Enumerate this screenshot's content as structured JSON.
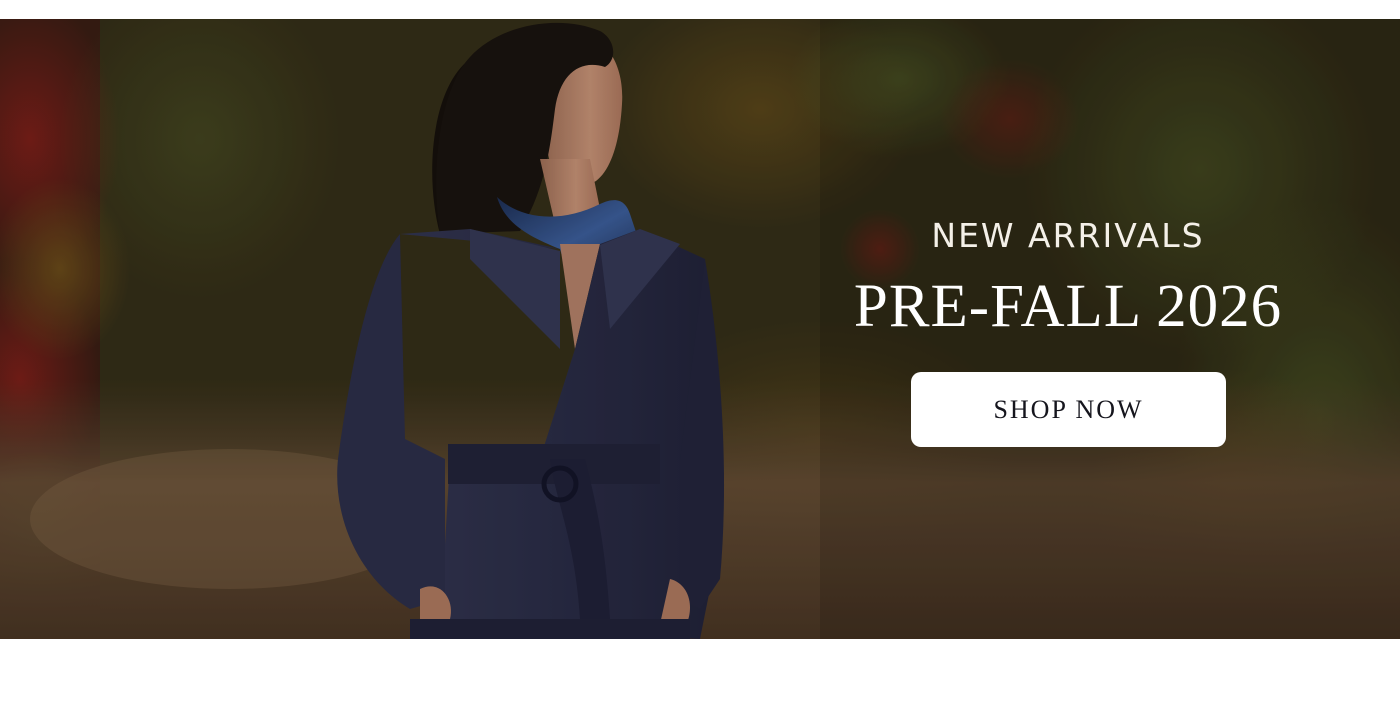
{
  "hero": {
    "eyebrow": "NEW ARRIVALS",
    "headline": "PRE-FALL 2026",
    "cta_label": "SHOP NOW"
  },
  "colors": {
    "page_background": "#ffffff",
    "button_background": "#ffffff",
    "button_text": "#15151d",
    "headline_text": "#ffffff",
    "blazer_navy": "#2a2c46"
  }
}
